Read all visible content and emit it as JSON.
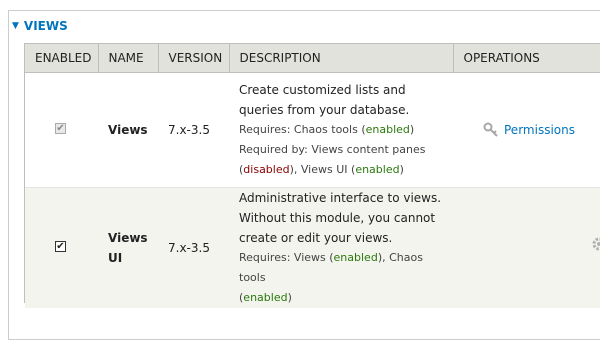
{
  "section": {
    "title": "VIEWS",
    "toggle_icon": "triangle-down-icon"
  },
  "columns": [
    "ENABLED",
    "NAME",
    "VERSION",
    "DESCRIPTION",
    "OPERATIONS"
  ],
  "rows": [
    {
      "name": "Views",
      "version": "7.x-3.5",
      "checked": true,
      "disabled": true,
      "desc_line1": "Create customized lists and",
      "desc_line2": "queries from your database.",
      "req_prefix": "Requires: Chaos tools (",
      "req_status": "enabled",
      "req_suffix": ")",
      "reqby_line1": "Required by: Views content panes",
      "reqby_open": "(",
      "reqby_status1": "disabled",
      "reqby_mid": "), Views UI (",
      "reqby_status2": "enabled",
      "reqby_close": ")",
      "operation": "Permissions",
      "operation_icon": "key-icon"
    },
    {
      "name_line1": "Views",
      "name_line2": "UI",
      "version": "7.x-3.5",
      "checked": true,
      "disabled": false,
      "desc_line1": "Administrative interface to views.",
      "desc_line2": "Without this module, you cannot",
      "desc_line3": "create or edit your views.",
      "req_prefix": "Requires: Views (",
      "req_status1": "enabled",
      "req_mid": "), Chaos tools",
      "req_open2": "(",
      "req_status2": "enabled",
      "req_close": ")",
      "operation_icon": "gear-icon"
    }
  ],
  "colors": {
    "link": "#0074bd",
    "enabled": "#2a7a0b",
    "disabled": "#8b0000",
    "header_bg": "#e1e2dc",
    "even_row_bg": "#f3f4ee"
  }
}
